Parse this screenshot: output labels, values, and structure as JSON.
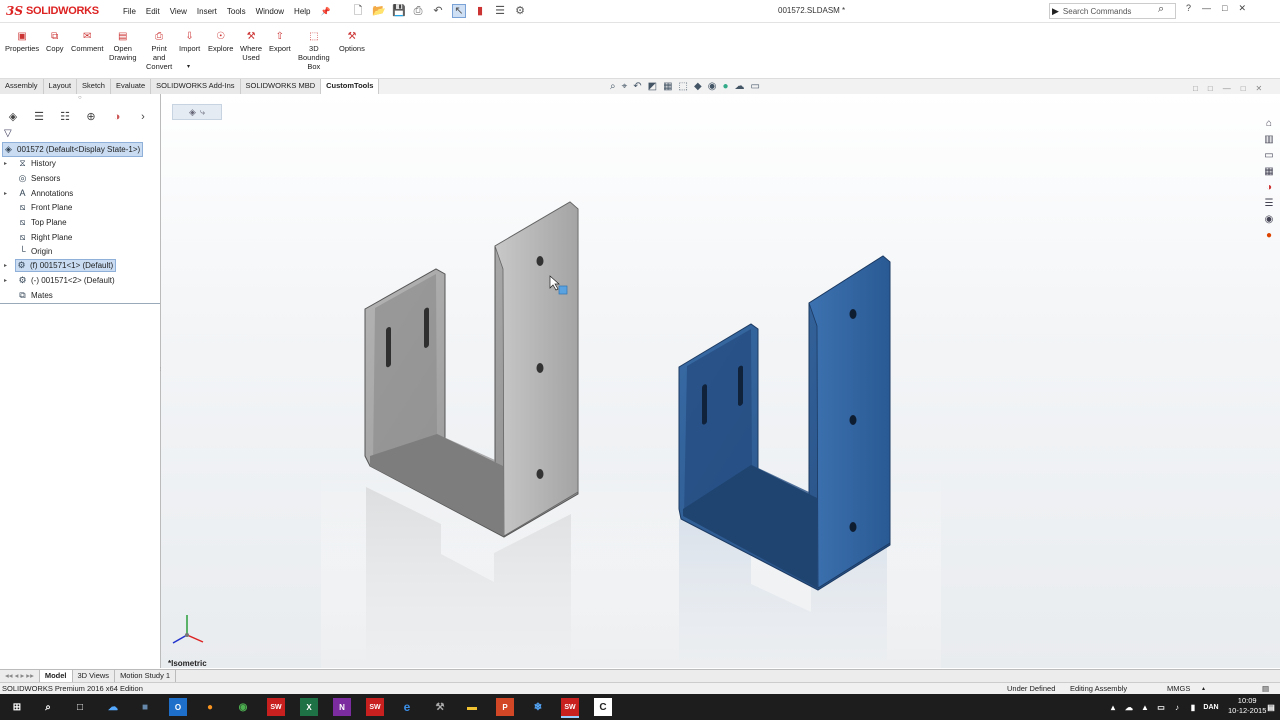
{
  "app": {
    "brand_mark": "3S",
    "brand_name": "SOLIDWORKS",
    "document_title": "001572.SLDASM *"
  },
  "menus": [
    "File",
    "Edit",
    "View",
    "Insert",
    "Tools",
    "Window",
    "Help"
  ],
  "search": {
    "placeholder": "Search Commands"
  },
  "toolbar": [
    {
      "label": "Properties",
      "icon": "properties-icon"
    },
    {
      "label": "Copy",
      "icon": "copy-icon"
    },
    {
      "label": "Comment",
      "icon": "comment-icon"
    },
    {
      "label": "Open\nDrawing",
      "icon": "open-drawing-icon"
    },
    {
      "label": "Print\nand\nConvert",
      "icon": "print-icon"
    },
    {
      "label": "Import",
      "icon": "import-icon"
    },
    {
      "label": "Explore",
      "icon": "explore-icon"
    },
    {
      "label": "Where\nUsed",
      "icon": "where-used-icon"
    },
    {
      "label": "Export",
      "icon": "export-icon"
    },
    {
      "label": "3D\nBounding\nBox",
      "icon": "bounding-box-icon"
    },
    {
      "label": "Options",
      "icon": "options-icon"
    }
  ],
  "tabs": [
    "Assembly",
    "Layout",
    "Sketch",
    "Evaluate",
    "SOLIDWORKS Add-Ins",
    "SOLIDWORKS MBD",
    "CustomTools"
  ],
  "active_tab": "CustomTools",
  "tree": {
    "root": "001572  (Default<Display State-1>)",
    "items": [
      "History",
      "Sensors",
      "Annotations",
      "Front Plane",
      "Top Plane",
      "Right Plane",
      "Origin",
      "(f) 001571<1> (Default)",
      "(-) 001571<2> (Default)",
      "Mates"
    ]
  },
  "viewport": {
    "view_label": "*Isometric",
    "part_colors": {
      "left": "#9a9a9a",
      "right": "#2e5d95"
    }
  },
  "bottom_tabs": [
    "Model",
    "3D Views",
    "Motion Study 1"
  ],
  "status": {
    "edition": "SOLIDWORKS Premium 2016 x64 Edition",
    "definition": "Under Defined",
    "mode": "Editing Assembly",
    "units": "MMGS"
  },
  "taskbar": {
    "language": "DAN",
    "time": "10:09",
    "date": "10-12-2015"
  }
}
